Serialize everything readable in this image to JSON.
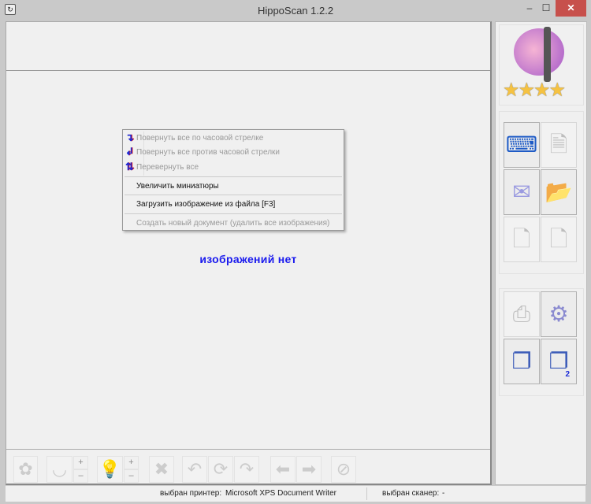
{
  "window": {
    "title": "HippoScan 1.2.2",
    "minimize": "‒",
    "maximize": "☐",
    "close": "✕"
  },
  "context_menu": {
    "items": [
      {
        "label": "Повернуть все по часовой стрелке",
        "enabled": false,
        "icon": "rotate-cw-icon"
      },
      {
        "label": "Повернуть все против часовой стрелки",
        "enabled": false,
        "icon": "rotate-ccw-icon"
      },
      {
        "label": "Перевернуть все",
        "enabled": false,
        "icon": "flip-icon"
      },
      {
        "label": "Увеличить миниатюры",
        "enabled": true
      },
      {
        "label": "Загрузить изображение из файла [F3]",
        "enabled": true
      },
      {
        "label": "Создать новый документ (удалить все изображения)",
        "enabled": false
      }
    ]
  },
  "main": {
    "empty_text": "изображений нет"
  },
  "toolbar": {
    "plus": "+",
    "minus": "–"
  },
  "status": {
    "printer_label": "выбран принтер:",
    "printer_value": "Microsoft XPS Document Writer",
    "scanner_label": "выбран сканер:",
    "scanner_value": "-"
  },
  "right_panel": {
    "page2_badge": "2"
  }
}
